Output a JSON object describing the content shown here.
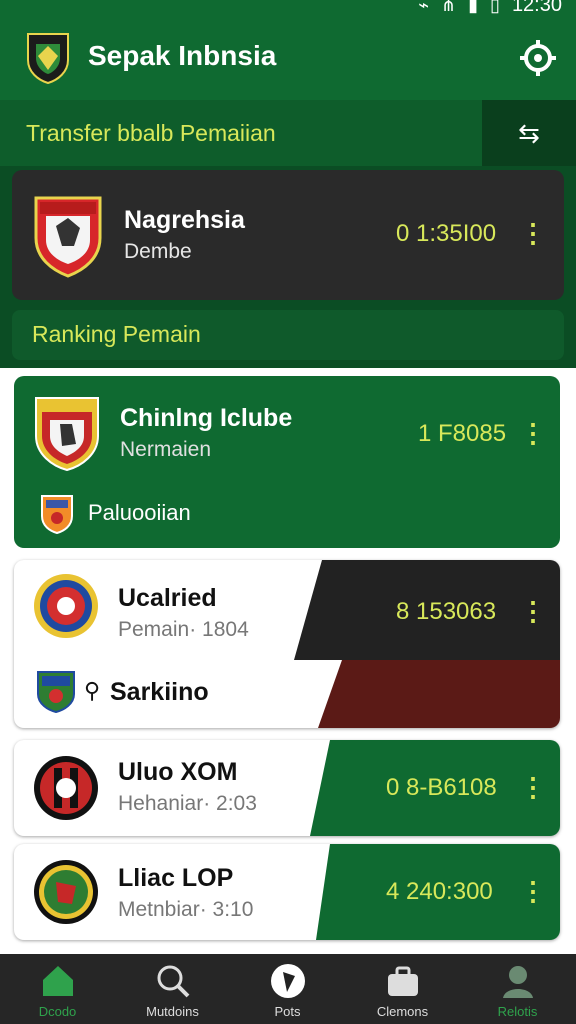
{
  "status": {
    "time": "12:30"
  },
  "app": {
    "title": "Sepak Inbnsia"
  },
  "sections": {
    "transfer_title": "Transfer bbalb Pemaiian",
    "ranking_title": "Ranking Pemain"
  },
  "top_card": {
    "name": "Nagrehsia",
    "sub": "Dembe",
    "value": "0  1:35I00"
  },
  "list": [
    {
      "name": "Chinlng Iclube",
      "sub": "Nermaien",
      "value": "1  F8085",
      "extra_label": "Paluooiian"
    },
    {
      "name": "Ucalried",
      "sub": "Pemain· 1804",
      "value": "8  153063",
      "extra_label": "Sarkiino"
    },
    {
      "name": "Uluo XOM",
      "sub": "Hehaniar· 2:03",
      "value": "0  8-B6108"
    },
    {
      "name": "Lliac LOP",
      "sub": "Metnbiar· 3:10",
      "value": "4  240:300"
    }
  ],
  "bottom_nav": [
    {
      "label": "Dcodo",
      "icon": "home-icon",
      "color": "#2fa24c"
    },
    {
      "label": "Mutdoins",
      "icon": "search-icon",
      "color": "#dddddd"
    },
    {
      "label": "Pots",
      "icon": "ball-icon",
      "color": "#dddddd"
    },
    {
      "label": "Clemons",
      "icon": "briefcase-icon",
      "color": "#dddddd"
    },
    {
      "label": "Relotis",
      "icon": "profile-icon",
      "color": "#2fa24c"
    }
  ]
}
